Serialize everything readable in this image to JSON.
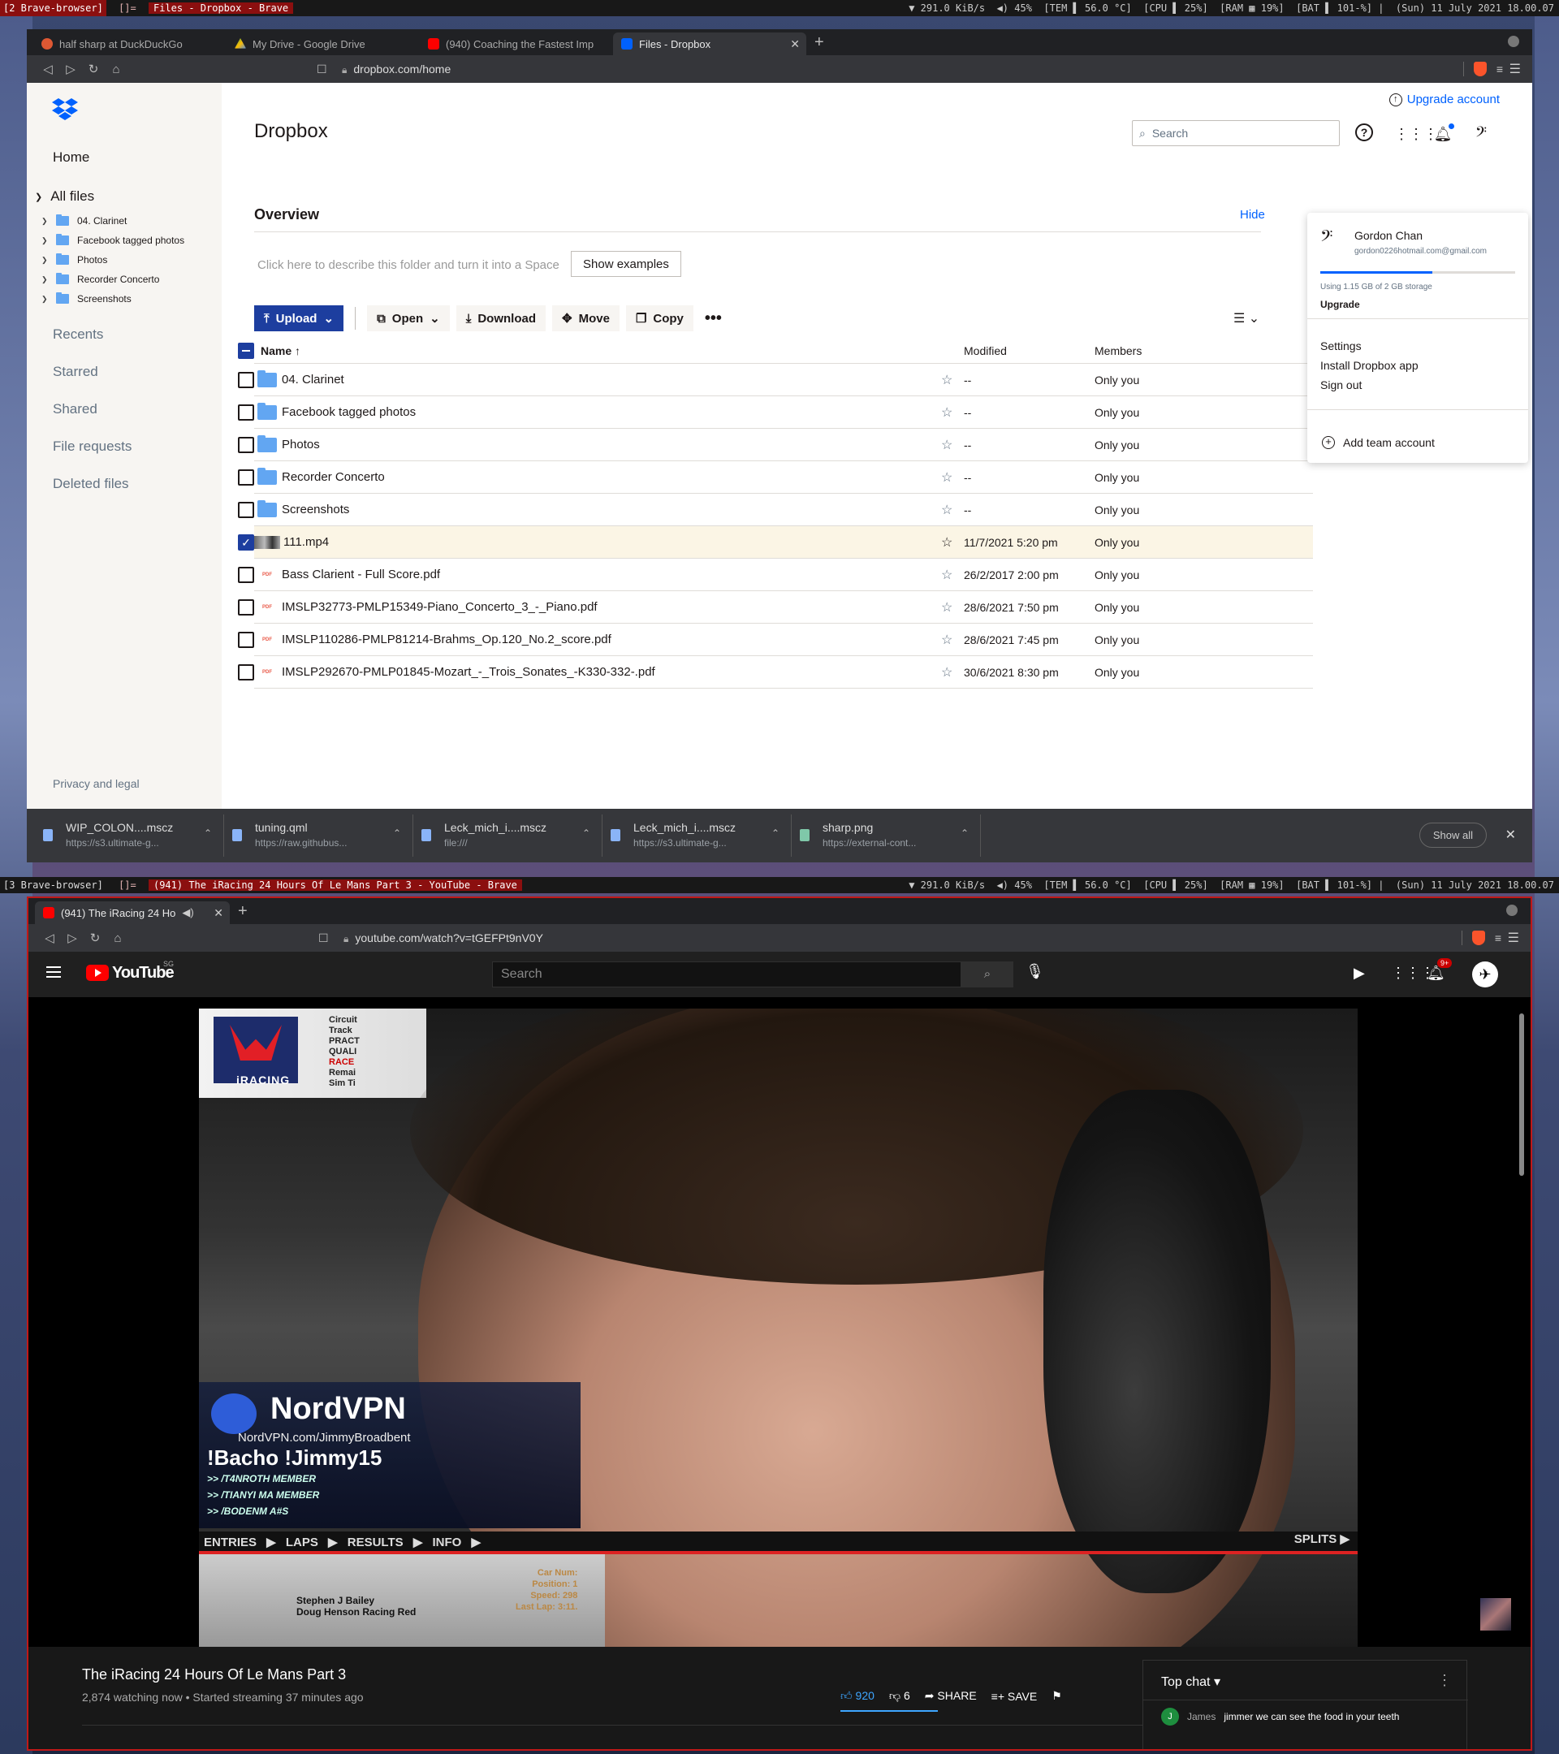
{
  "statusbar_top": {
    "workspace": "[2 Brave-browser]",
    "layout": "[]=",
    "title": "Files - Dropbox - Brave",
    "net": "▼ 291.0 KiB/s",
    "vol": "◀) 45%",
    "temp": "[TEM ▌ 56.0 °C]",
    "cpu": "[CPU ▌ 25%]",
    "ram": "[RAM ▦ 19%]",
    "bat": "[BAT ▌ 101-%]",
    "date": "(Sun) 11 July 2021 18.00.07"
  },
  "statusbar_bottom": {
    "workspace": "[3 Brave-browser]",
    "layout": "[]=",
    "title": "(941) The iRacing 24 Hours Of Le Mans Part 3 - YouTube - Brave",
    "net": "▼ 291.0 KiB/s",
    "vol": "◀) 45%",
    "temp": "[TEM ▌ 56.0 °C]",
    "cpu": "[CPU ▌ 25%]",
    "ram": "[RAM ▦ 19%]",
    "bat": "[BAT ▌ 101-%]",
    "date": "(Sun) 11 July 2021 18.00.07"
  },
  "browser_top": {
    "tabs": [
      {
        "label": "half sharp at DuckDuckGo",
        "favicon": "duckduckgo-icon",
        "color": "#de5833"
      },
      {
        "label": "My Drive - Google Drive",
        "favicon": "google-drive-icon",
        "color": "#34a853"
      },
      {
        "label": "(940) Coaching the Fastest Imp",
        "favicon": "youtube-icon",
        "color": "#ff0000"
      },
      {
        "label": "Files - Dropbox",
        "favicon": "dropbox-icon",
        "color": "#0061fe"
      }
    ],
    "url": "dropbox.com/home"
  },
  "dropbox": {
    "sidebar": {
      "home": "Home",
      "all_files": "All files",
      "tree": [
        "04. Clarinet",
        "Facebook tagged photos",
        "Photos",
        "Recorder Concerto",
        "Screenshots"
      ],
      "recents": "Recents",
      "starred": "Starred",
      "shared": "Shared",
      "file_requests": "File requests",
      "deleted_files": "Deleted files",
      "privacy": "Privacy and legal"
    },
    "upgrade_link": "Upgrade account",
    "title": "Dropbox",
    "search_placeholder": "Search",
    "overview": "Overview",
    "hide": "Hide",
    "describe": "Click here to describe this folder and turn it into a Space",
    "show_examples": "Show examples",
    "toolbar": {
      "upload": "Upload",
      "open": "Open",
      "download": "Download",
      "move": "Move",
      "copy": "Copy",
      "more": "•••"
    },
    "columns": {
      "name": "Name",
      "modified": "Modified",
      "members": "Members"
    },
    "rows": [
      {
        "name": "04. Clarinet",
        "type": "folder",
        "modified": "--",
        "members": "Only you"
      },
      {
        "name": "Facebook tagged photos",
        "type": "folder",
        "modified": "--",
        "members": "Only you"
      },
      {
        "name": "Photos",
        "type": "folder",
        "modified": "--",
        "members": "Only you"
      },
      {
        "name": "Recorder Concerto",
        "type": "folder",
        "modified": "--",
        "members": "Only you"
      },
      {
        "name": "Screenshots",
        "type": "folder",
        "modified": "--",
        "members": "Only you"
      },
      {
        "name": "111.mp4",
        "type": "video",
        "modified": "11/7/2021 5:20 pm",
        "members": "Only you"
      },
      {
        "name": "Bass Clarient - Full Score.pdf",
        "type": "pdf",
        "modified": "26/2/2017 2:00 pm",
        "members": "Only you"
      },
      {
        "name": "IMSLP32773-PMLP15349-Piano_Concerto_3_-_Piano.pdf",
        "type": "pdf",
        "modified": "28/6/2021 7:50 pm",
        "members": "Only you"
      },
      {
        "name": "IMSLP110286-PMLP81214-Brahms_Op.120_No.2_score.pdf",
        "type": "pdf",
        "modified": "28/6/2021 7:45 pm",
        "members": "Only you"
      },
      {
        "name": "IMSLP292670-PMLP01845-Mozart_-_Trois_Sonates_-K330-332-.pdf",
        "type": "pdf",
        "modified": "30/6/2021 8:30 pm",
        "members": "Only you"
      }
    ],
    "account": {
      "name": "Gordon Chan",
      "email": "gordon0226hotmail.com@gmail.com",
      "storage_fraction": 0.575,
      "using": "Using 1.15 GB of 2 GB storage",
      "upgrade": "Upgrade",
      "settings": "Settings",
      "install": "Install Dropbox app",
      "signout": "Sign out",
      "add_team": "Add team account"
    }
  },
  "downloads": [
    {
      "file": "WIP_COLON....mscz",
      "src": "https://s3.ultimate-g..."
    },
    {
      "file": "tuning.qml",
      "src": "https://raw.githubus..."
    },
    {
      "file": "Leck_mich_i....mscz",
      "src": "file:///"
    },
    {
      "file": "Leck_mich_i....mscz",
      "src": "https://s3.ultimate-g..."
    },
    {
      "file": "sharp.png",
      "src": "https://external-cont..."
    }
  ],
  "downloads_show_all": "Show all",
  "browser_bottom": {
    "tab": "(941) The iRacing 24 Ho",
    "url": "youtube.com/watch?v=tGEFPt9nV0Y"
  },
  "youtube": {
    "logo_text": "YouTube",
    "region": "SG",
    "search_placeholder": "Search",
    "notif_badge": "9+",
    "video_overlay": {
      "iracing": "iRACING",
      "hud_lines": [
        "Circuit",
        "Track",
        "PRACT",
        "QUALI",
        "RACE",
        "Remai",
        "Sim Ti"
      ],
      "nord_brand": "NordVPN",
      "nord_url": "NordVPN.com/JimmyBroadbent",
      "command": "!Bacho !Jimmy15",
      "members": [
        ">> /T4NROTH MEMBER",
        ">> /TIANYI MA MEMBER",
        ">> /BODENM A#S"
      ],
      "tabs": "ENTRIES ▶ LAPS ▶ RESULTS ▶ INFO ▶",
      "splits": "SPLITS ▶",
      "driver1": "Stephen J Bailey",
      "driver2": "Doug Henson Racing Red",
      "car_lines": [
        "Car Num:",
        "Position: 1",
        "Speed: 298",
        "Last Lap: 3:11."
      ]
    },
    "video_title": "The iRacing 24 Hours Of Le Mans Part 3",
    "meta": "2,874 watching now • Started streaming 37 minutes ago",
    "likes": "920",
    "dislikes": "6",
    "share": "SHARE",
    "save": "SAVE",
    "chat_header": "Top chat",
    "chat_msg": {
      "initial": "J",
      "author": "James",
      "text": "jimmer we can see the food in your teeth"
    }
  },
  "colors": {
    "dropbox_blue": "#0061fe",
    "upload_navy": "#1d3e9f",
    "youtube_red": "#ff0000",
    "statusbar_red": "#8b0f0f"
  }
}
